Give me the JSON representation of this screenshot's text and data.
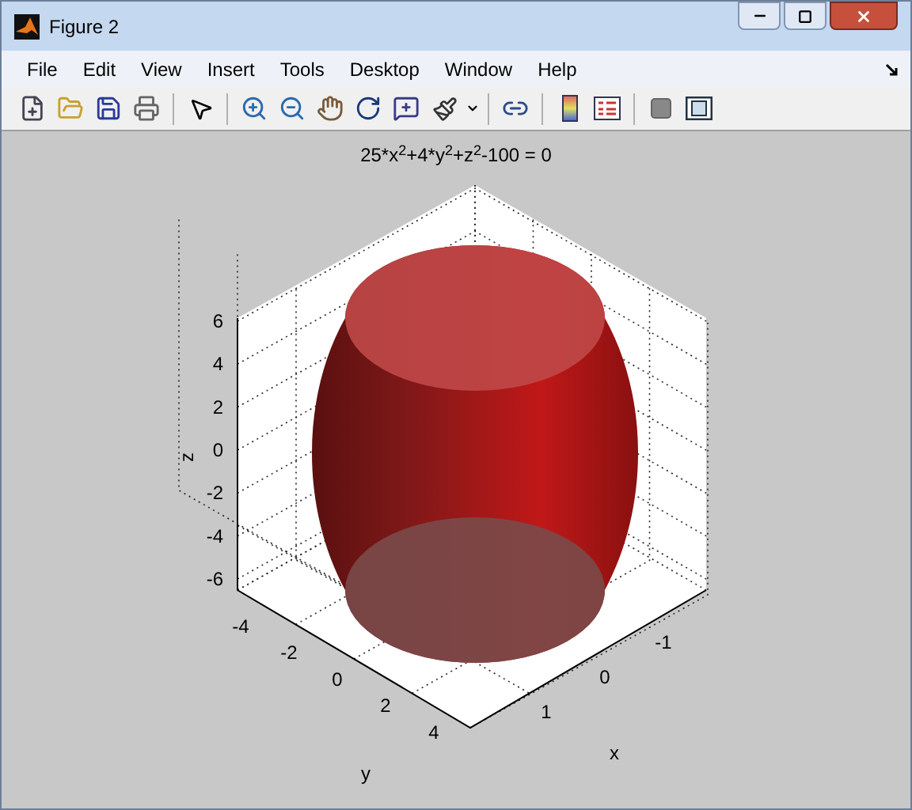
{
  "window": {
    "title": "Figure 2"
  },
  "menu": [
    "File",
    "Edit",
    "View",
    "Insert",
    "Tools",
    "Desktop",
    "Window",
    "Help"
  ],
  "plot": {
    "title": "25*x$^{2}$+4*y$^{2}$+z$^{2}$-100 = 0",
    "z_label": "z",
    "y_label": "y",
    "x_label": "x",
    "z_ticks": [
      "6",
      "4",
      "2",
      "0",
      "-2",
      "-4",
      "-6"
    ],
    "y_ticks": [
      "-4",
      "-2",
      "0",
      "2",
      "4"
    ],
    "x_ticks": [
      "1",
      "0",
      "-1"
    ]
  }
}
